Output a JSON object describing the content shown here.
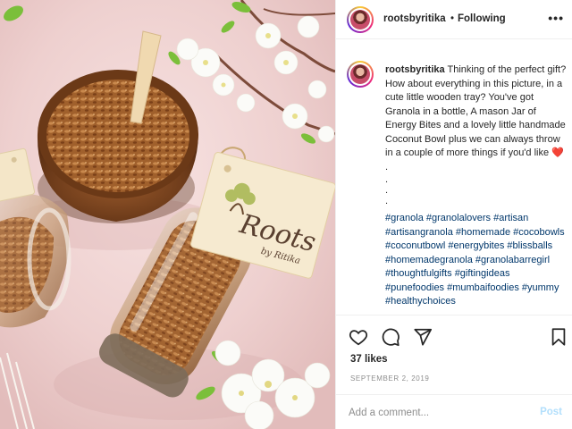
{
  "post": {
    "username": "rootsbyritika",
    "separator": "•",
    "follow_status": "Following",
    "more_icon": "more-horizontal-icon",
    "caption": {
      "username": "rootsbyritika",
      "text": "Thinking of the perfect gift? How about everything in this picture, in a cute little wooden tray? You've got Granola in a bottle, A mason Jar of Energy Bites and a lovely little handmade Coconut Bowl plus we can always throw in a couple of more things if you'd like",
      "emoji": "❤️",
      "end": " .",
      "dots": [
        ".",
        ".",
        "."
      ],
      "hashtags": [
        "#granola",
        "#granolalovers",
        "#artisan",
        "#artisangranola",
        "#homemade",
        "#cocobowls",
        "#coconutbowl",
        "#energybites",
        "#blissballs",
        "#homemadegranola",
        "#granolabarregirl",
        "#thoughtfulgifts",
        "#giftingideas",
        "#punefoodies",
        "#mumbaifoodies",
        "#yummy",
        "#healthychoices"
      ]
    },
    "likes": "37 likes",
    "date": "SEPTEMBER 2, 2019",
    "comment_placeholder": "Add a comment...",
    "post_button": "Post",
    "photo": {
      "tag_brand": "Roots",
      "tag_sub": "by Ritika"
    }
  },
  "colors": {
    "link": "#00376b",
    "muted": "#8e8e8e",
    "post_disabled": "#b2dffc",
    "heart": "#ed4956"
  }
}
